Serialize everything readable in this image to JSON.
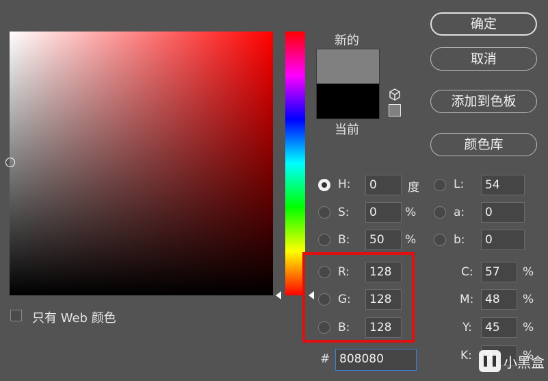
{
  "dialog": {
    "swatch_new_label": "新的",
    "swatch_current_label": "当前",
    "new_color": "#808080",
    "current_color": "#000000",
    "web_only_label": "只有 Web 颜色"
  },
  "buttons": {
    "ok": "确定",
    "cancel": "取消",
    "add_to_swatches": "添加到色板",
    "color_libraries": "颜色库"
  },
  "hsb": {
    "h": {
      "label": "H:",
      "value": "0",
      "unit": "度"
    },
    "s": {
      "label": "S:",
      "value": "0",
      "unit": "%"
    },
    "b": {
      "label": "B:",
      "value": "50",
      "unit": "%"
    }
  },
  "lab": {
    "l": {
      "label": "L:",
      "value": "54"
    },
    "a": {
      "label": "a:",
      "value": "0"
    },
    "b": {
      "label": "b:",
      "value": "0"
    }
  },
  "rgb": {
    "r": {
      "label": "R:",
      "value": "128"
    },
    "g": {
      "label": "G:",
      "value": "128"
    },
    "b": {
      "label": "B:",
      "value": "128"
    }
  },
  "cmyk": {
    "c": {
      "label": "C:",
      "value": "57",
      "unit": "%"
    },
    "m": {
      "label": "M:",
      "value": "48",
      "unit": "%"
    },
    "y": {
      "label": "Y:",
      "value": "45",
      "unit": "%"
    },
    "k": {
      "label": "K:",
      "value": "0",
      "unit": "%"
    }
  },
  "hex": {
    "label": "#",
    "value": "808080"
  },
  "watermark": {
    "text": "小黑盒"
  },
  "colors": {
    "background": "#535353",
    "highlight": "#e01010",
    "hue": "#ff0000"
  }
}
